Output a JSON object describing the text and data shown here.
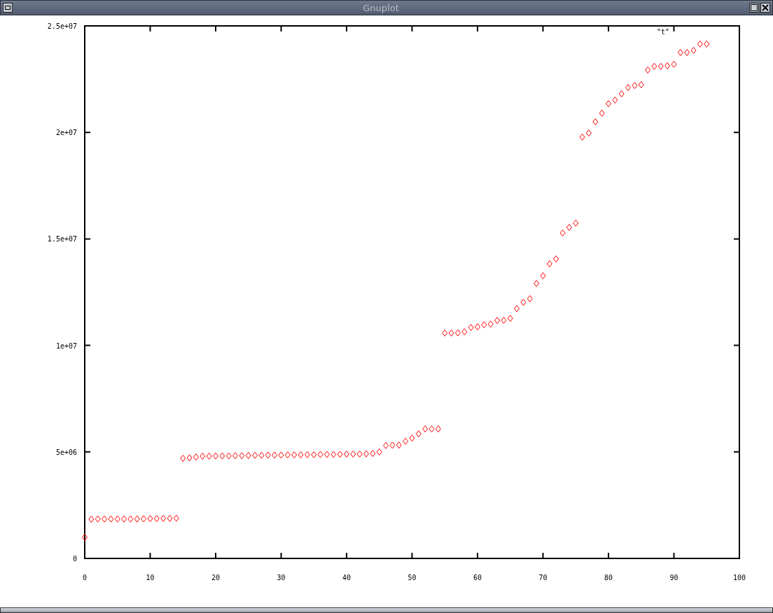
{
  "window": {
    "title": "Gnuplot"
  },
  "plot": {
    "chart_data": {
      "type": "scatter",
      "xlim": [
        0,
        100
      ],
      "ylim": [
        0,
        25000000
      ],
      "xticks": [
        0,
        10,
        20,
        30,
        40,
        50,
        60,
        70,
        80,
        90,
        100
      ],
      "yticks": [
        {
          "value": 0,
          "label": "0"
        },
        {
          "value": 5000000,
          "label": "5e+06"
        },
        {
          "value": 10000000,
          "label": "1e+07"
        },
        {
          "value": 15000000,
          "label": "1.5e+07"
        },
        {
          "value": 20000000,
          "label": "2e+07"
        },
        {
          "value": 25000000,
          "label": "2.5e+07"
        }
      ],
      "x": [
        0,
        1,
        2,
        3,
        4,
        5,
        6,
        7,
        8,
        9,
        10,
        11,
        12,
        13,
        14,
        15,
        16,
        17,
        18,
        19,
        20,
        21,
        22,
        23,
        24,
        25,
        26,
        27,
        28,
        29,
        30,
        31,
        32,
        33,
        34,
        35,
        36,
        37,
        38,
        39,
        40,
        41,
        42,
        43,
        44,
        45,
        46,
        47,
        48,
        49,
        50,
        51,
        52,
        53,
        54,
        55,
        56,
        57,
        58,
        59,
        60,
        61,
        62,
        63,
        64,
        65,
        66,
        67,
        68,
        69,
        70,
        71,
        72,
        73,
        74,
        75,
        76,
        77,
        78,
        79,
        80,
        81,
        82,
        83,
        84,
        85,
        86,
        87,
        88,
        89,
        90,
        91,
        92,
        93,
        94,
        95
      ],
      "series": [
        {
          "name": "\"t\"",
          "color": "#ff0000",
          "values": [
            990000,
            1840000,
            1850000,
            1850000,
            1850000,
            1850000,
            1850000,
            1850000,
            1850000,
            1860000,
            1870000,
            1870000,
            1880000,
            1880000,
            1890000,
            4700000,
            4720000,
            4760000,
            4800000,
            4800000,
            4810000,
            4810000,
            4810000,
            4820000,
            4820000,
            4830000,
            4840000,
            4840000,
            4850000,
            4850000,
            4850000,
            4860000,
            4860000,
            4860000,
            4870000,
            4870000,
            4880000,
            4880000,
            4880000,
            4890000,
            4900000,
            4900000,
            4900000,
            4910000,
            4930000,
            5000000,
            5300000,
            5310000,
            5320000,
            5500000,
            5650000,
            5850000,
            6080000,
            6080000,
            6080000,
            10580000,
            10580000,
            10590000,
            10640000,
            10840000,
            10870000,
            10970000,
            11000000,
            11170000,
            11180000,
            11270000,
            11730000,
            12020000,
            12190000,
            12910000,
            13270000,
            13830000,
            14060000,
            15280000,
            15540000,
            15740000,
            19780000,
            19970000,
            20500000,
            20900000,
            21350000,
            21520000,
            21810000,
            22100000,
            22200000,
            22240000,
            22930000,
            23100000,
            23100000,
            23130000,
            23200000,
            23750000,
            23750000,
            23850000,
            24150000,
            24150000
          ]
        }
      ]
    }
  }
}
